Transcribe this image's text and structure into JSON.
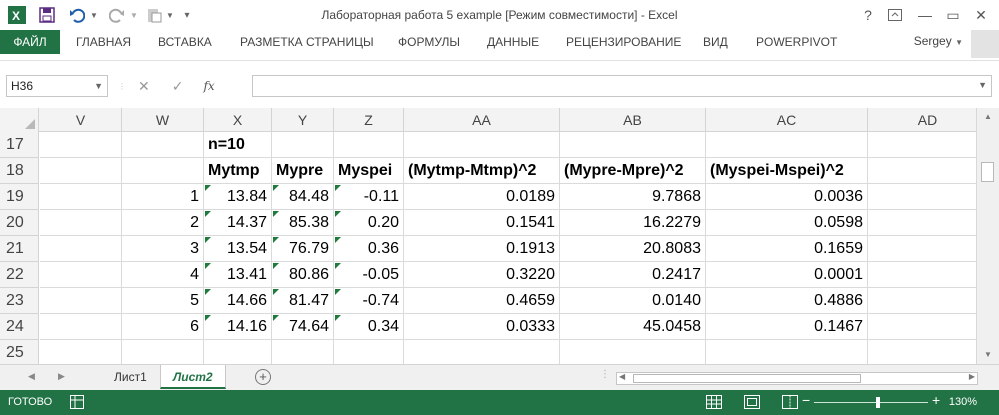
{
  "title": "Лабораторная работа 5 example  [Режим совместимости] - Excel",
  "ribbon": {
    "file": "ФАЙЛ",
    "tabs": [
      "ГЛАВНАЯ",
      "ВСТАВКА",
      "РАЗМЕТКА СТРАНИЦЫ",
      "ФОРМУЛЫ",
      "ДАННЫЕ",
      "РЕЦЕНЗИРОВАНИЕ",
      "ВИД",
      "POWERPIVOT"
    ],
    "user": "Sergey"
  },
  "window": {
    "help": "?",
    "minimize": "—",
    "maximize": "▭",
    "close": "✕"
  },
  "formula_bar": {
    "name_box": "H36",
    "fx": "fx",
    "value": ""
  },
  "columns": [
    "V",
    "W",
    "X",
    "Y",
    "Z",
    "AA",
    "AB",
    "AC",
    "AD"
  ],
  "rows": [
    {
      "n": "17",
      "cells": [
        "",
        "",
        "n=10",
        "",
        "",
        "",
        "",
        "",
        ""
      ]
    },
    {
      "n": "18",
      "cells": [
        "",
        "",
        "Mytmp",
        "Mypre",
        "Myspei",
        "(Mytmp-Mtmp)^2",
        "(Mypre-Mpre)^2",
        "(Myspei-Mspei)^2",
        ""
      ]
    },
    {
      "n": "19",
      "cells": [
        "",
        "1",
        "13.84",
        "84.48",
        "-0.11",
        "0.0189",
        "9.7868",
        "0.0036",
        ""
      ]
    },
    {
      "n": "20",
      "cells": [
        "",
        "2",
        "14.37",
        "85.38",
        "0.20",
        "0.1541",
        "16.2279",
        "0.0598",
        ""
      ]
    },
    {
      "n": "21",
      "cells": [
        "",
        "3",
        "13.54",
        "76.79",
        "0.36",
        "0.1913",
        "20.8083",
        "0.1659",
        ""
      ]
    },
    {
      "n": "22",
      "cells": [
        "",
        "4",
        "13.41",
        "80.86",
        "-0.05",
        "0.3220",
        "0.2417",
        "0.0001",
        ""
      ]
    },
    {
      "n": "23",
      "cells": [
        "",
        "5",
        "14.66",
        "81.47",
        "-0.74",
        "0.4659",
        "0.0140",
        "0.4886",
        ""
      ]
    },
    {
      "n": "24",
      "cells": [
        "",
        "6",
        "14.16",
        "74.64",
        "0.34",
        "0.0333",
        "45.0458",
        "0.1467",
        ""
      ]
    },
    {
      "n": "25",
      "cells": [
        "",
        "",
        "",
        "",
        "",
        "",
        "",
        "",
        ""
      ]
    }
  ],
  "sheets": {
    "tab1": "Лист1",
    "tab2": "Лист2",
    "add": "+"
  },
  "status": {
    "text": "ГОТОВО",
    "zoom": "130%"
  },
  "colors": {
    "accent": "#217346",
    "warning_triangle": "#1e7b3c"
  }
}
